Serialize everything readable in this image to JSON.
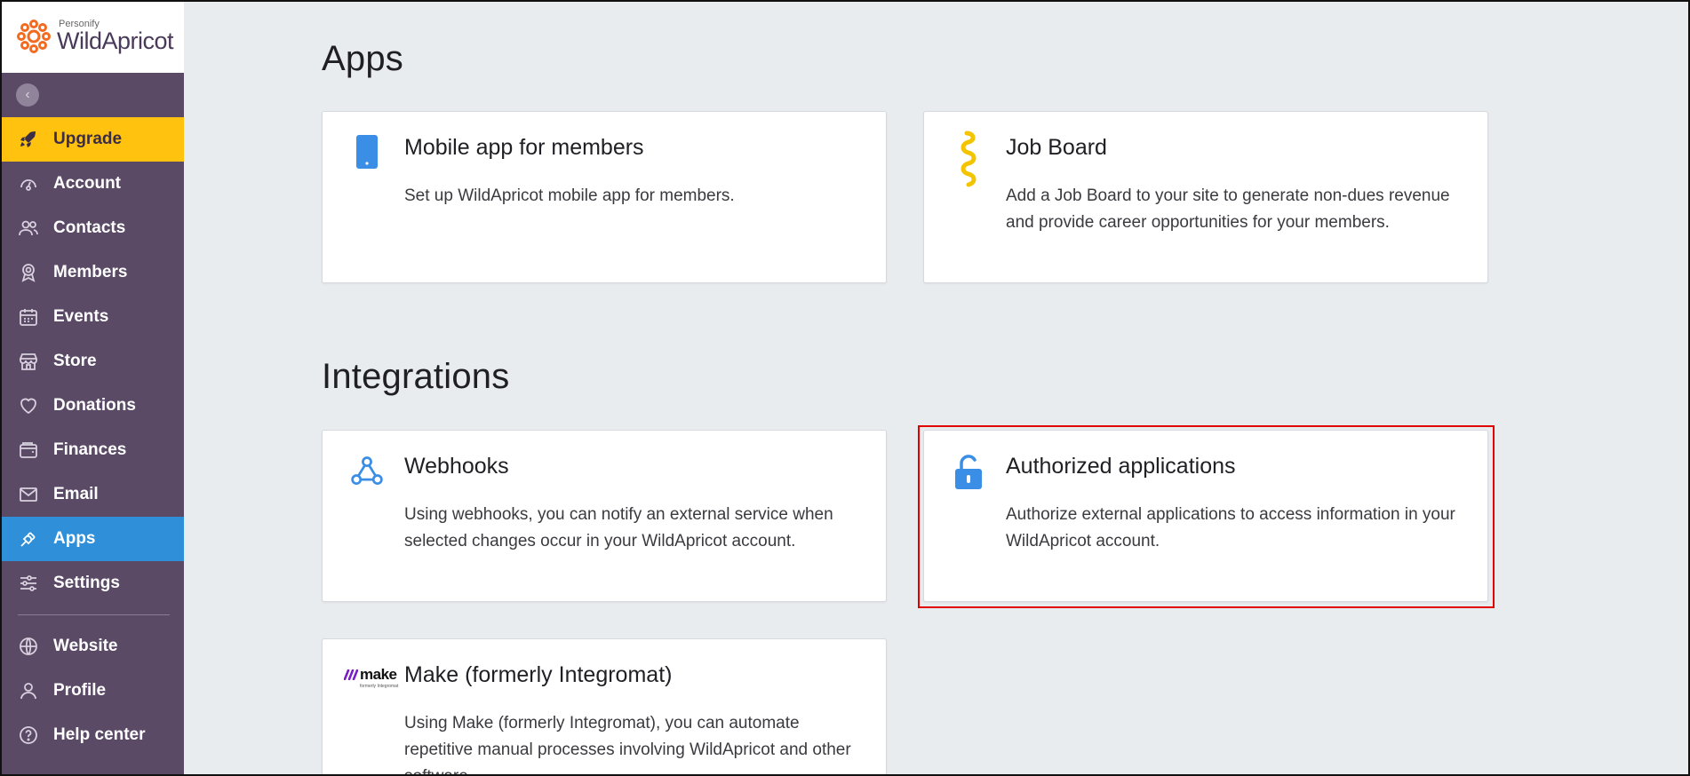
{
  "logo": {
    "brand_small": "Personify",
    "brand_main": "WildApricot"
  },
  "sidebar": {
    "collapse_icon": "chevron-left-icon",
    "items": [
      {
        "label": "Upgrade",
        "icon": "rocket-icon",
        "state": "upgrade"
      },
      {
        "label": "Account",
        "icon": "gauge-icon"
      },
      {
        "label": "Contacts",
        "icon": "contacts-icon"
      },
      {
        "label": "Members",
        "icon": "members-badge-icon"
      },
      {
        "label": "Events",
        "icon": "calendar-icon"
      },
      {
        "label": "Store",
        "icon": "store-icon"
      },
      {
        "label": "Donations",
        "icon": "heart-icon"
      },
      {
        "label": "Finances",
        "icon": "wallet-icon"
      },
      {
        "label": "Email",
        "icon": "mail-icon"
      },
      {
        "label": "Apps",
        "icon": "plug-icon",
        "state": "active"
      },
      {
        "label": "Settings",
        "icon": "sliders-icon"
      }
    ],
    "bottom_items": [
      {
        "label": "Website",
        "icon": "globe-icon"
      },
      {
        "label": "Profile",
        "icon": "user-icon"
      },
      {
        "label": "Help center",
        "icon": "help-circle-icon"
      }
    ]
  },
  "apps_section": {
    "title": "Apps",
    "cards": [
      {
        "title": "Mobile app for members",
        "description": "Set up WildApricot mobile app for members.",
        "icon": "mobile-phone-icon"
      },
      {
        "title": "Job Board",
        "description": "Add a Job Board to your site to generate non-dues revenue and provide career opportunities for your members.",
        "icon": "job-board-icon"
      }
    ]
  },
  "integrations_section": {
    "title": "Integrations",
    "cards": [
      {
        "title": "Webhooks",
        "description": "Using webhooks, you can notify an external service when selected changes occur in your WildApricot account.",
        "icon": "webhook-icon"
      },
      {
        "title": "Authorized applications",
        "description": "Authorize external applications to access information in your WildApricot account.",
        "icon": "unlock-icon",
        "highlighted": true
      },
      {
        "title": "Make (formerly Integromat)",
        "description": "Using Make (formerly Integromat), you can automate repetitive manual processes involving WildApricot and other software.",
        "icon": "make-logo-icon",
        "logo_text": "make",
        "logo_subtext": "formerly Integromat"
      }
    ]
  },
  "colors": {
    "sidebar_bg": "#5b4a66",
    "upgrade_bg": "#ffc20e",
    "active_bg": "#2f8fd8",
    "accent_blue": "#3b8ee6",
    "accent_yellow": "#f5c400",
    "highlight_border": "#e00000"
  }
}
